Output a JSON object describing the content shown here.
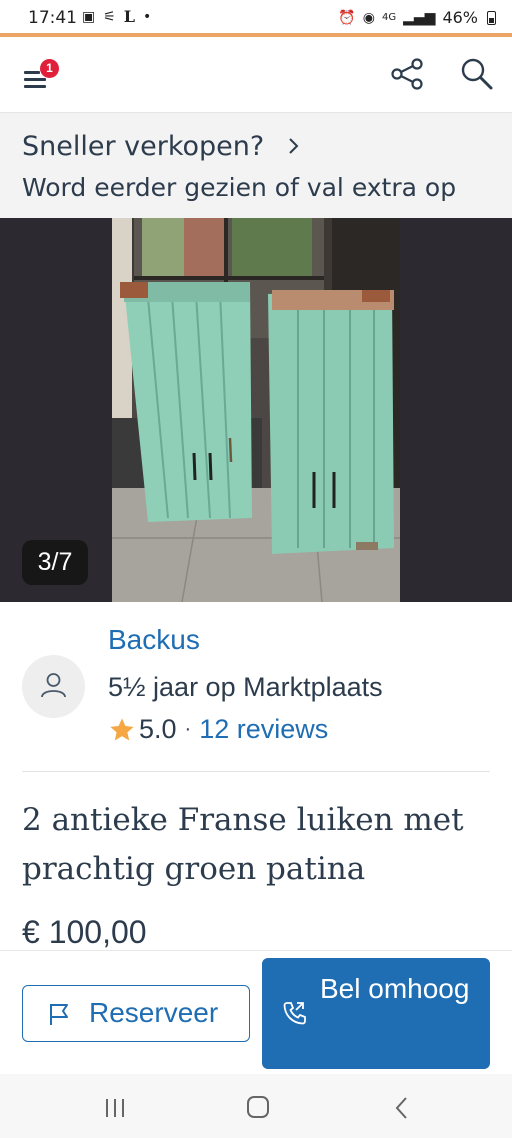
{
  "status_bar": {
    "time": "17:41",
    "network": "4G",
    "battery": "46%",
    "left_icons": [
      "gallery-icon",
      "wifi-calling-icon",
      "lidl-icon",
      "dot-icon"
    ],
    "right_icons": [
      "alarm-icon",
      "mute-icon",
      "signal-icon",
      "battery-icon"
    ]
  },
  "header": {
    "menu_badge": "1",
    "icons": [
      "menu-icon",
      "share-icon",
      "search-icon"
    ]
  },
  "promo": {
    "title": "Sneller verkopen?",
    "subtitle": "Word eerder gezien of val extra op"
  },
  "gallery": {
    "counter": "3/7"
  },
  "seller": {
    "name": "Backus",
    "since": "5½ jaar op Marktplaats",
    "rating": "5.0",
    "separator": "·",
    "reviews": "12 reviews"
  },
  "ad": {
    "title": "2 antieke Franse luiken met prachtig groen patina",
    "price": "€ 100,00"
  },
  "actions": {
    "reserve": "Reserveer",
    "call": "Bel omhoog"
  },
  "colors": {
    "accent_blue": "#1f6db3",
    "brand_orange": "#eda566",
    "text_dark": "#2d3c4d",
    "star": "#f4a742",
    "badge_red": "#e0203b"
  }
}
